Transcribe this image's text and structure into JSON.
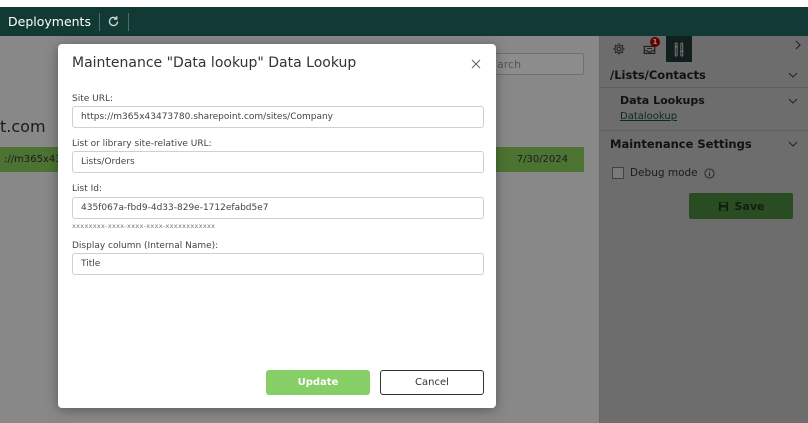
{
  "topbar": {
    "tab_label": "Deployments"
  },
  "main": {
    "search_placeholder": "arch",
    "site_title": "t.com",
    "row": {
      "url": "://m365x43",
      "date": "7/30/2024"
    }
  },
  "panel": {
    "list_path": "/Lists/Contacts",
    "data_lookups_title": "Data Lookups",
    "data_lookup_link": "Datalookup",
    "maintenance_settings": "Maintenance Settings",
    "debug_mode_label": "Debug mode",
    "save_label": "Save",
    "badge_count": "1"
  },
  "modal": {
    "title": "Maintenance \"Data lookup\" Data Lookup",
    "site_url_label": "Site URL:",
    "site_url_value": "https://m365x43473780.sharepoint.com/sites/Company",
    "list_url_label": "List or library site-relative URL:",
    "list_url_value": "Lists/Orders",
    "list_id_label": "List Id:",
    "list_id_value": "435f067a-fbd9-4d33-829e-1712efabd5e7",
    "list_id_hint": "xxxxxxxx-xxxx-xxxx-xxxx-xxxxxxxxxxxx",
    "display_column_label": "Display column (Internal Name):",
    "display_column_value": "Title",
    "update_label": "Update",
    "cancel_label": "Cancel"
  },
  "colors": {
    "topbar": "#123a34",
    "accent_green": "#8dd15c",
    "update_button": "#86cf66",
    "save_button": "#4c8a40"
  }
}
